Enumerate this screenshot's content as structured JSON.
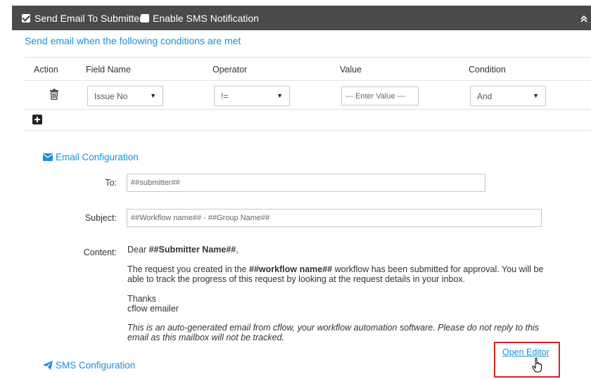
{
  "topbar": {
    "send_email_label": "Send Email To Submitter",
    "send_email_checked": true,
    "sms_label": "Enable SMS Notification",
    "sms_checked": false
  },
  "conditions": {
    "title": "Send email when the following conditions are met",
    "columns": [
      "Action",
      "Field Name",
      "Operator",
      "Value",
      "Condition"
    ],
    "row": {
      "field_name": "Issue No",
      "operator": "!=",
      "value_placeholder": "--- Enter Value ---",
      "condition": "And"
    }
  },
  "email_config": {
    "title": "Email Configuration",
    "to_label": "To:",
    "to_value": "##submitter##",
    "subject_label": "Subject:",
    "subject_value": "##Workflow name## - ##Group Name##",
    "content_label": "Content:",
    "content": {
      "greeting_prefix": "Dear ",
      "greeting_bold": "##Submitter Name##",
      "greeting_suffix": ",",
      "body_prefix": "The request you created in the ",
      "body_bold": "##workflow name##",
      "body_suffix": " workflow has been submitted for approval. You will be able to track the progress of this request by looking at the request details in your inbox.",
      "thanks": "Thanks",
      "signature": "cflow emailer",
      "footer": "This is an auto-generated email from cflow, your workflow automation software. Please do not reply to this email as this mailbox will not be tracked."
    },
    "open_editor": "Open Editor"
  },
  "sms_config": {
    "title": "SMS Configuration"
  },
  "colors": {
    "accent": "#1a8fd8",
    "topbar": "#4a4a4a",
    "highlight": "#e02020"
  }
}
